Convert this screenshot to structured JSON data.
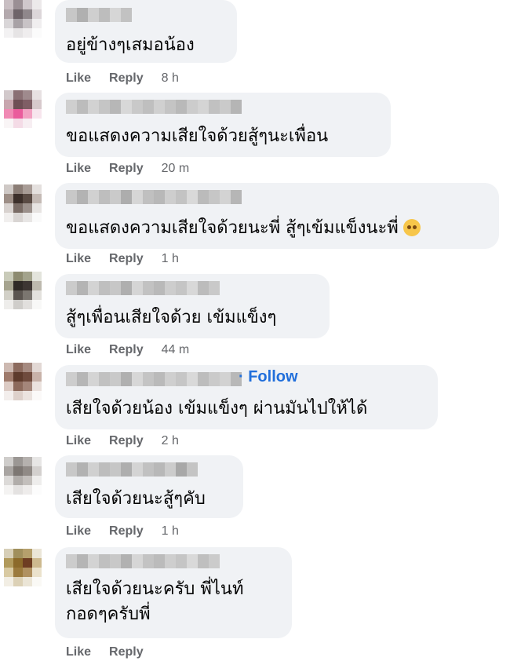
{
  "comments": [
    {
      "text_lines": [
        "อยู่ข้างๆเสมอน้อง"
      ],
      "actions": {
        "like": "Like",
        "reply": "Reply",
        "time": "8 h"
      },
      "avatar_colors": [
        "#c9bfc3",
        "#9a8f94",
        "#cfc7cb",
        "#ece9ea",
        "#b3a9ad",
        "#6e6469",
        "#8f878b",
        "#dcd6d9",
        "#d9d6d8",
        "#a8a2a6",
        "#c8c3c6",
        "#f0eeef",
        "#f3f2f3",
        "#e6e4e5",
        "#efedee",
        "#fbfbfb"
      ],
      "name_blur": [
        "#c7c7c7",
        "#b0b0b0",
        "#cfcfcf",
        "#bdbdbd",
        "#d6d6d6",
        "#c2c2c2"
      ]
    },
    {
      "text_lines": [
        "ขอแสดงความเสียใจด้วยสู้ๆนะเพื่อน"
      ],
      "actions": {
        "like": "Like",
        "reply": "Reply",
        "time": "20 m"
      },
      "avatar_colors": [
        "#d2c9cb",
        "#8a7074",
        "#9f8a8d",
        "#e7e1e2",
        "#c8a6ae",
        "#6e4f55",
        "#7f5e65",
        "#d7c9cc",
        "#f08ab4",
        "#ea5c9c",
        "#f2a1c2",
        "#f7e5ed",
        "#f9f5f6",
        "#f4dbe6",
        "#f7eef2",
        "#ffffff"
      ],
      "name_blur": [
        "#cfcfcf",
        "#bcbcbc",
        "#d2d2d2",
        "#c5c5c5",
        "#b7b7b7",
        "#d8d8d8",
        "#c9c9c9",
        "#bfbfbf",
        "#d0d0d0",
        "#c4c4c4",
        "#b9b9b9",
        "#cccccc",
        "#d4d4d4",
        "#c1c1c1",
        "#cacaca",
        "#b5b5b5"
      ]
    },
    {
      "text_lines": [
        "ขอแสดงความเสียใจด้วยนะพี่ สู้ๆเข้มแข็งนะพี่"
      ],
      "emoji": "pleading-face",
      "actions": {
        "like": "Like",
        "reply": "Reply",
        "time": "1 h"
      },
      "avatar_colors": [
        "#cfc9c6",
        "#8b7d76",
        "#a89c96",
        "#e4e0de",
        "#9d8e86",
        "#3c2f2a",
        "#5a4b44",
        "#c4bab5",
        "#d8d2cf",
        "#7a6c66",
        "#9c918c",
        "#e7e4e2",
        "#f1efee",
        "#d9d5d3",
        "#e8e6e5",
        "#fafafa"
      ],
      "name_blur": [
        "#c8c8c8",
        "#b3b3b3",
        "#d1d1d1",
        "#bebebe",
        "#cacaca",
        "#adadad",
        "#d6d6d6",
        "#c0c0c0",
        "#b8b8b8",
        "#cecece",
        "#c3c3c3",
        "#d9d9d9",
        "#bbbbbb",
        "#c6c6c6",
        "#d3d3d3",
        "#b6b6b6"
      ]
    },
    {
      "text_lines": [
        "สู้ๆเพื่อนเสียใจด้วย เข้มแข็งๆ"
      ],
      "actions": {
        "like": "Like",
        "reply": "Reply",
        "time": "44 m"
      },
      "avatar_colors": [
        "#c9cbb9",
        "#8d8b70",
        "#a3a38c",
        "#e3e4dc",
        "#a6a48f",
        "#2f2a26",
        "#3d3633",
        "#bdb9ae",
        "#d2d0c7",
        "#5b5550",
        "#7b7670",
        "#e3e1dd",
        "#eeedeb",
        "#cfcdca",
        "#e1dfdd",
        "#f8f8f7"
      ],
      "name_blur": [
        "#cbcbcb",
        "#b4b4b4",
        "#d3d3d3",
        "#bfbfbf",
        "#c7c7c7",
        "#afafaf",
        "#d5d5d5",
        "#c2c2c2",
        "#b9b9b9",
        "#cdcdcd",
        "#c5c5c5",
        "#d8d8d8",
        "#bcbcbc",
        "#c9c9c9"
      ]
    },
    {
      "text_lines": [
        "เสียใจด้วยน้อง เข้มแข็งๆ ผ่านมันไปให้ได้"
      ],
      "follow": "· Follow",
      "actions": {
        "like": "Like",
        "reply": "Reply",
        "time": "2 h"
      },
      "avatar_colors": [
        "#cdb9b1",
        "#8c6b5e",
        "#a58a80",
        "#e2d8d4",
        "#9f7b6c",
        "#5e3b2c",
        "#6f4b3d",
        "#c8b2a9",
        "#dccbc4",
        "#8c6a5c",
        "#a4867a",
        "#ebe2de",
        "#f3eeec",
        "#ddd0ca",
        "#ebe3df",
        "#fbf9f8"
      ],
      "name_blur": [
        "#cdcdcd",
        "#b6b6b6",
        "#d4d4d4",
        "#c1c1c1",
        "#c9c9c9",
        "#b0b0b0",
        "#d7d7d7",
        "#c4c4c4",
        "#bababa",
        "#cfcfcf",
        "#c6c6c6",
        "#d9d9d9",
        "#bdbdbd",
        "#cacaca",
        "#d2d2d2",
        "#b8b8b8"
      ]
    },
    {
      "text_lines": [
        "เสียใจด้วยนะสู้ๆคับ"
      ],
      "actions": {
        "like": "Like",
        "reply": "Reply",
        "time": "1 h"
      },
      "avatar_colors": [
        "#cfcdcb",
        "#9b9794",
        "#b5b1ae",
        "#e7e6e5",
        "#a9a5a2",
        "#7d7773",
        "#908a86",
        "#d3d0ce",
        "#dcdad8",
        "#b1adaa",
        "#c3bfbc",
        "#eeedec",
        "#f4f3f2",
        "#e4e2e1",
        "#eeeceb",
        "#fcfcfc"
      ],
      "name_blur": [
        "#c8c8c8",
        "#b2b2b2",
        "#d0d0d0",
        "#bdbdbd",
        "#c6c6c6",
        "#aeaeae",
        "#d4d4d4",
        "#c1c1c1",
        "#b8b8b8",
        "#cccccc",
        "#a8a8a8",
        "#c4c4c4"
      ]
    },
    {
      "text_lines": [
        "เสียใจด้วยนะครับ พี่ไนท์",
        "กอดๆครับพี่"
      ],
      "actions": {
        "like": "Like",
        "reply": "Reply",
        "time": ""
      },
      "avatar_colors": [
        "#d7cfb8",
        "#a08f5d",
        "#b59f6c",
        "#ebe6d8",
        "#b19a5c",
        "#8c6a2a",
        "#6e3d22",
        "#cdb98f",
        "#d9caa2",
        "#9b7a3c",
        "#b09160",
        "#ebe2cc",
        "#f2eee4",
        "#dcd1b6",
        "#ebe5d6",
        "#faf9f5"
      ],
      "name_blur": [
        "#cccccc",
        "#b5b5b5",
        "#d3d3d3",
        "#c0c0c0",
        "#c8c8c8",
        "#b1b1b1",
        "#d6d6d6",
        "#c3c3c3",
        "#bbbbbb",
        "#cecece",
        "#c5c5c5",
        "#d9d9d9",
        "#bfbfbf",
        "#cbcbcb"
      ]
    }
  ]
}
